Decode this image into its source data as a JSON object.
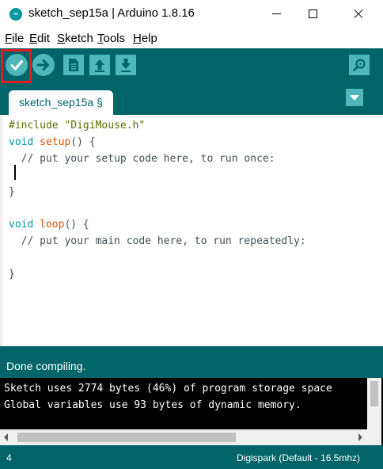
{
  "window": {
    "title": "sketch_sep15a | Arduino 1.8.16",
    "app_icon": "arduino-icon"
  },
  "menu": [
    {
      "mnemonic": "F",
      "rest": "ile"
    },
    {
      "mnemonic": "E",
      "rest": "dit"
    },
    {
      "mnemonic": "S",
      "rest": "ketch"
    },
    {
      "mnemonic": "T",
      "rest": "ools"
    },
    {
      "mnemonic": "H",
      "rest": "elp"
    }
  ],
  "toolbar": {
    "buttons": [
      {
        "name": "verify",
        "icon": "checkmark-icon",
        "highlighted": true
      },
      {
        "name": "upload",
        "icon": "arrow-right-icon"
      },
      {
        "name": "new",
        "icon": "new-file-icon"
      },
      {
        "name": "open",
        "icon": "arrow-up-icon"
      },
      {
        "name": "save",
        "icon": "arrow-down-icon"
      },
      {
        "name": "serial-monitor",
        "icon": "magnifier-icon"
      }
    ],
    "highlight_color": "#e31b23"
  },
  "tab": {
    "label": "sketch_sep15a §"
  },
  "editor": {
    "lines": [
      "#include \"DigiMouse.h\"",
      "void setup() {",
      "  // put your setup code here, to run once:",
      "",
      "}",
      "",
      "void loop() {",
      "  // put your main code here, to run repeatedly:",
      "",
      "}"
    ]
  },
  "status": {
    "message": "Done compiling."
  },
  "console": {
    "lines": [
      "Sketch uses 2774 bytes (46%) of program storage space",
      "Global variables use 93 bytes of dynamic memory."
    ]
  },
  "footer": {
    "line_number": "4",
    "board": "Digispark (Default - 16.5mhz)"
  },
  "colors": {
    "teal_dark": "#006468",
    "teal_light": "#4db7bb",
    "keyword": "#00979c",
    "function": "#d35400",
    "preprocessor": "#5e6d03"
  }
}
